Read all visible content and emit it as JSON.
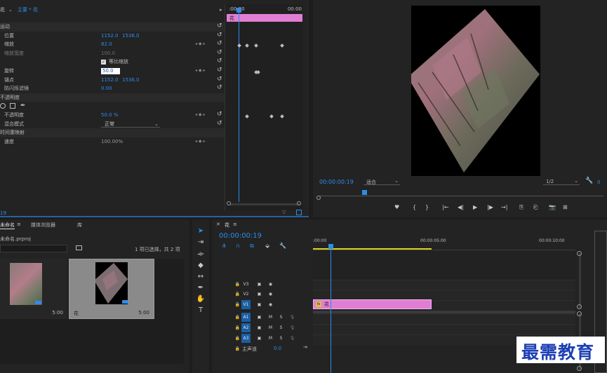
{
  "effect_controls": {
    "tab_label": "花",
    "clip_path": "主要 * 花",
    "props": [
      {
        "label": "运动",
        "v1": "",
        "v2": ""
      },
      {
        "label": "位置",
        "v1": "1152.0",
        "v2": "1536.0"
      },
      {
        "label": "缩放",
        "v1": "82.0",
        "v2": ""
      },
      {
        "label": "缩放宽度",
        "v1": "100.0",
        "v2": ""
      },
      {
        "label": "等比缩放",
        "v1": "",
        "v2": ""
      },
      {
        "label": "旋转",
        "v1": "50.0",
        "v2": ""
      },
      {
        "label": "锚点",
        "v1": "1152.0",
        "v2": "1536.0"
      },
      {
        "label": "防闪烁滤镜",
        "v1": "0.00",
        "v2": ""
      },
      {
        "label": "不透明度",
        "v1": "",
        "v2": ""
      },
      {
        "label": "",
        "v1": "",
        "v2": ""
      },
      {
        "label": "不透明度",
        "v1": "50.0 %",
        "v2": ""
      },
      {
        "label": "混合模式",
        "v1": "正常",
        "v2": ""
      },
      {
        "label": "时间重映射",
        "v1": "",
        "v2": ""
      },
      {
        "label": "速度",
        "v1": "100.00%",
        "v2": ""
      }
    ],
    "mini_ruler_start": ":00:00",
    "mini_ruler_end": "00:00",
    "mini_clip_label": "花",
    "bottom_timecode": "19"
  },
  "program_monitor": {
    "timecode": "00:00:00:19",
    "fit_label": "适合",
    "quality_label": "1/2",
    "controls": [
      "♥",
      "{",
      "}",
      "|←",
      "◀|",
      "▶",
      "|▶",
      "→|",
      "⎘",
      "⎗",
      "📷",
      "⊞"
    ]
  },
  "project_panel": {
    "tabs": [
      "未命名",
      "媒体浏览器",
      "库"
    ],
    "project_file": "未命名.prproj",
    "selection_info": "1 项已选择，共 2 项",
    "items": [
      {
        "name": "",
        "duration": "5:00"
      },
      {
        "name": "花",
        "duration": "5:00"
      }
    ]
  },
  "timeline": {
    "tab_label": "花",
    "timecode": "00:00:00:19",
    "ruler": [
      ":00:00",
      "00:00:05:00",
      "00:00:10:00"
    ],
    "video_tracks": [
      "V3",
      "V2",
      "V1"
    ],
    "audio_tracks": [
      "A1",
      "A2",
      "A3"
    ],
    "master_label": "主声道",
    "master_value": "0.0",
    "clip_label": "花",
    "clip_fx": "fx"
  },
  "watermark": "最需教育",
  "colors": {
    "clip_pink": "#e07ed4",
    "accent_blue": "#2d8ceb",
    "work_area_yellow": "#d8d21c"
  }
}
